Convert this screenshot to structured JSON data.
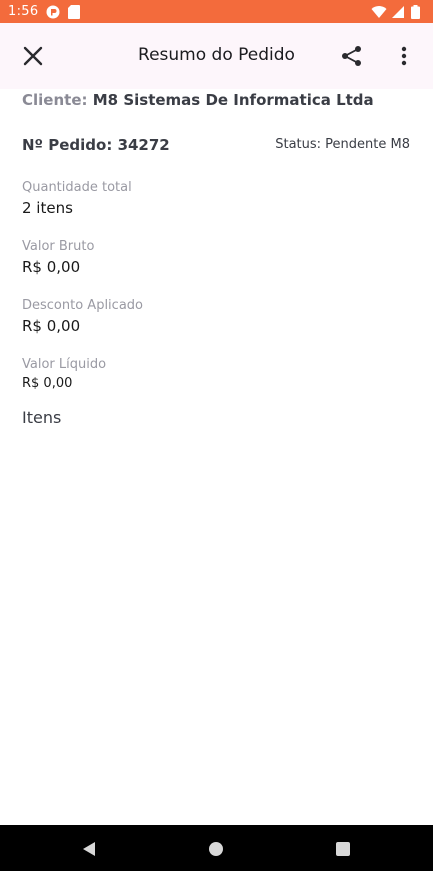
{
  "status_bar": {
    "time": "1:56",
    "icons": [
      "app-notification-icon",
      "sim-card-icon",
      "wifi-icon",
      "signal-icon",
      "battery-icon"
    ]
  },
  "app_bar": {
    "title": "Resumo do Pedido",
    "close_icon": "close-icon",
    "share_icon": "share-icon",
    "more_icon": "more-vert-icon"
  },
  "order": {
    "cliente_label": "Cliente:",
    "cliente_value": "M8 Sistemas De Informatica Ltda",
    "pedido_label": "Nº Pedido:",
    "pedido_number": "34272",
    "status_text": "Status: Pendente M8"
  },
  "fields": [
    {
      "label": "Quantidade total",
      "value": "2 itens"
    },
    {
      "label": "Valor Bruto",
      "value": "R$ 0,00"
    },
    {
      "label": "Desconto Aplicado",
      "value": "R$ 0,00"
    },
    {
      "label": "Valor Líquido",
      "value": "R$ 0,00"
    }
  ],
  "itens_title": "Itens",
  "colors": {
    "status_bar": "#f36b3c",
    "app_bar": "#fdf6fb",
    "label_gray": "#9a9aa3",
    "text_dark": "#3a3d45"
  }
}
